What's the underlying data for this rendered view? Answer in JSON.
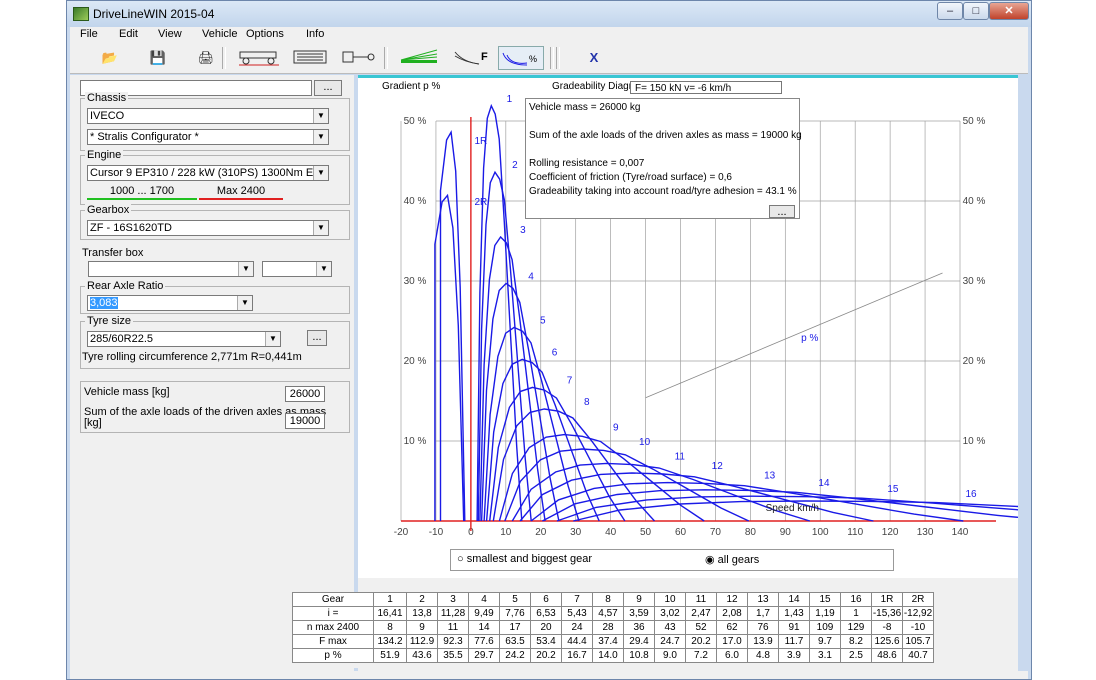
{
  "window": {
    "title": "DriveLineWIN 2015-04"
  },
  "menu": [
    "File",
    "Edit",
    "View",
    "Vehicle",
    "Options",
    "Info"
  ],
  "left": {
    "top_button": "...",
    "chassis": {
      "label": "Chassis",
      "make": "IVECO",
      "model": "* Stralis Configurator *"
    },
    "engine": {
      "label": "Engine",
      "value": "Cursor 9 EP310 / 228 kW (310PS) 1300Nm Euro 6",
      "range": "1000 ... 1700",
      "max": "Max 2400"
    },
    "gearbox": {
      "label": "Gearbox",
      "value": "ZF - 16S1620TD"
    },
    "transfer": {
      "label": "Transfer box"
    },
    "axle": {
      "label": "Rear Axle Ratio",
      "value": "3,083"
    },
    "tyre": {
      "label": "Tyre size",
      "value": "285/60R22.5",
      "button": "...",
      "info": "Tyre rolling circumference 2,771m   R=0,441m"
    },
    "vehicle_mass_label": "Vehicle mass [kg]",
    "vehicle_mass": "26000",
    "axle_load_label_1": "Sum of the axle loads of the driven axles as mass",
    "axle_load_label_2": "[kg]",
    "axle_load": "19000"
  },
  "chart_header": {
    "gradient": "Gradient p %",
    "diagram": "Gradeability Diagram",
    "force_field": "F= 150 kN   v= -6 km/h"
  },
  "popup": {
    "line1": "Vehicle mass = 26000 kg",
    "line2": "Sum of the axle loads of the driven axles as mass = 19000 kg",
    "line3": "Rolling resistance = 0,007",
    "line4": "Coefficient of friction (Tyre/road surface) = 0,6",
    "line5": "Gradeability taking into account road/tyre adhesion = 43.1 %",
    "button": "..."
  },
  "radios": {
    "opt1": "smallest and biggest gear",
    "opt2": "all gears",
    "selected": "all gears"
  },
  "chart_data": {
    "type": "line",
    "xlabel": "Speed km/h",
    "ylabel": "Gradient p %",
    "xlim": [
      -20,
      140
    ],
    "ylim": [
      -2,
      55
    ],
    "x_ticks": [
      -20,
      -10,
      0,
      10,
      20,
      30,
      40,
      50,
      60,
      70,
      80,
      90,
      100,
      110,
      120,
      130,
      140
    ],
    "y_ticks": [
      10,
      20,
      30,
      40,
      50
    ],
    "y_tick_labels": [
      "10 %",
      "20 %",
      "30 %",
      "40 %",
      "50 %"
    ],
    "series_p_label": "p %",
    "adhesion_line": {
      "x": [
        50,
        135
      ],
      "y": [
        15.4,
        31
      ]
    },
    "gears": [
      {
        "name": "1",
        "vmax": 8.1,
        "pmax": 51.9
      },
      {
        "name": "2",
        "vmax": 9.6,
        "pmax": 43.6
      },
      {
        "name": "3",
        "vmax": 11.8,
        "pmax": 35.5
      },
      {
        "name": "4",
        "vmax": 14.0,
        "pmax": 29.7
      },
      {
        "name": "5",
        "vmax": 17.2,
        "pmax": 24.2
      },
      {
        "name": "6",
        "vmax": 20.4,
        "pmax": 20.2
      },
      {
        "name": "7",
        "vmax": 24.5,
        "pmax": 16.7
      },
      {
        "name": "8",
        "vmax": 29.2,
        "pmax": 14.0
      },
      {
        "name": "9",
        "vmax": 37.1,
        "pmax": 10.8
      },
      {
        "name": "10",
        "vmax": 44.2,
        "pmax": 9.0
      },
      {
        "name": "11",
        "vmax": 53.9,
        "pmax": 7.2
      },
      {
        "name": "12",
        "vmax": 64.0,
        "pmax": 6.0
      },
      {
        "name": "13",
        "vmax": 78.3,
        "pmax": 4.8
      },
      {
        "name": "14",
        "vmax": 93.1,
        "pmax": 3.9
      },
      {
        "name": "15",
        "vmax": 111.9,
        "pmax": 3.1
      },
      {
        "name": "16",
        "vmax": 133.2,
        "pmax": 2.5
      },
      {
        "name": "1R",
        "vmax": -8.7,
        "pmax": 48.6
      },
      {
        "name": "2R",
        "vmax": -10.3,
        "pmax": 40.7
      }
    ]
  },
  "gear_table": {
    "rows": [
      [
        "Gear",
        "1",
        "2",
        "3",
        "4",
        "5",
        "6",
        "7",
        "8",
        "9",
        "10",
        "11",
        "12",
        "13",
        "14",
        "15",
        "16",
        "1R",
        "2R"
      ],
      [
        "i =",
        "16,41",
        "13,8",
        "11,28",
        "9,49",
        "7,76",
        "6,53",
        "5,43",
        "4,57",
        "3,59",
        "3,02",
        "2,47",
        "2,08",
        "1,7",
        "1,43",
        "1,19",
        "1",
        "-15,36",
        "-12,92"
      ],
      [
        "n max 2400",
        "8",
        "9",
        "11",
        "14",
        "17",
        "20",
        "24",
        "28",
        "36",
        "43",
        "52",
        "62",
        "76",
        "91",
        "109",
        "129",
        "-8",
        "-10"
      ],
      [
        "F max",
        "134.2",
        "112.9",
        "92.3",
        "77.6",
        "63.5",
        "53.4",
        "44.4",
        "37.4",
        "29.4",
        "24.7",
        "20.2",
        "17.0",
        "13.9",
        "11.7",
        "9.7",
        "8.2",
        "125.6",
        "105.7"
      ],
      [
        "p %",
        "51.9",
        "43.6",
        "35.5",
        "29.7",
        "24.2",
        "20.2",
        "16.7",
        "14.0",
        "10.8",
        "9.0",
        "7.2",
        "6.0",
        "4.8",
        "3.9",
        "3.1",
        "2.5",
        "48.6",
        "40.7"
      ]
    ]
  },
  "colors": {
    "curve": "#1a1ae6",
    "axis_red": "#e02020",
    "range_green": "#20c020",
    "grid": "#a0a0a0",
    "accent_cyan": "#39c6d3"
  }
}
